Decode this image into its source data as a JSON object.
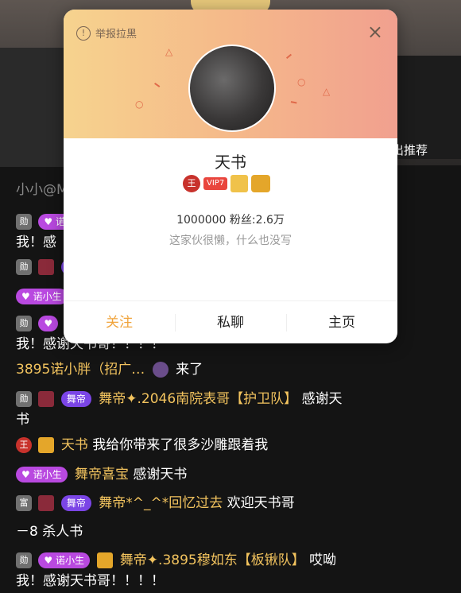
{
  "background": {
    "recommend_text": "出推荐",
    "room_name": "小小@M"
  },
  "profile_card": {
    "report_label": "举报拉黑",
    "close_icon": "×",
    "username": "天书",
    "vip_label": "VIP7",
    "king_label": "王",
    "id_text": "1000000",
    "fans_text": "粉丝:2.6万",
    "bio": "这家伙很懒，什么也没写",
    "actions": {
      "follow": "关注",
      "message": "私聊",
      "homepage": "主页"
    },
    "colors": {
      "gradient_start": "#f6d38e",
      "gradient_end": "#f1a08f",
      "follow": "#f0a33a"
    }
  },
  "chat": {
    "partial_lines": [
      {
        "badge": "诺",
        "text": "我！感"
      },
      {
        "badge": "舞"
      },
      {
        "badge": "诺小生"
      }
    ],
    "line_thanks_tail": "我！感谢天书哥！！！！",
    "arrival": {
      "name": "3895诺小胖（招广…",
      "action": "来了"
    },
    "msg1": {
      "level": "勋",
      "badge": "舞帝",
      "name": "舞帝✦.2046南院表哥【护卫队】",
      "text": "感谢天",
      "wrap": "书"
    },
    "msg2": {
      "level": "王",
      "name": "天书",
      "text": "我给你带来了很多沙雕跟着我"
    },
    "msg3": {
      "badge": "诺小生",
      "name": "舞帝喜宝",
      "text": "感谢天书"
    },
    "msg4": {
      "level": "富",
      "badge": "舞帝",
      "name": "舞帝*^_^*回忆过去",
      "text": "欢迎天书哥"
    },
    "msg5": {
      "text": "－8 杀人书"
    },
    "msg6": {
      "level": "勋",
      "badge": "诺小生",
      "name": "舞帝✦.3895穆如东【板锹队】",
      "text": "哎呦",
      "wrap": "我！感谢天书哥！！！！"
    }
  }
}
